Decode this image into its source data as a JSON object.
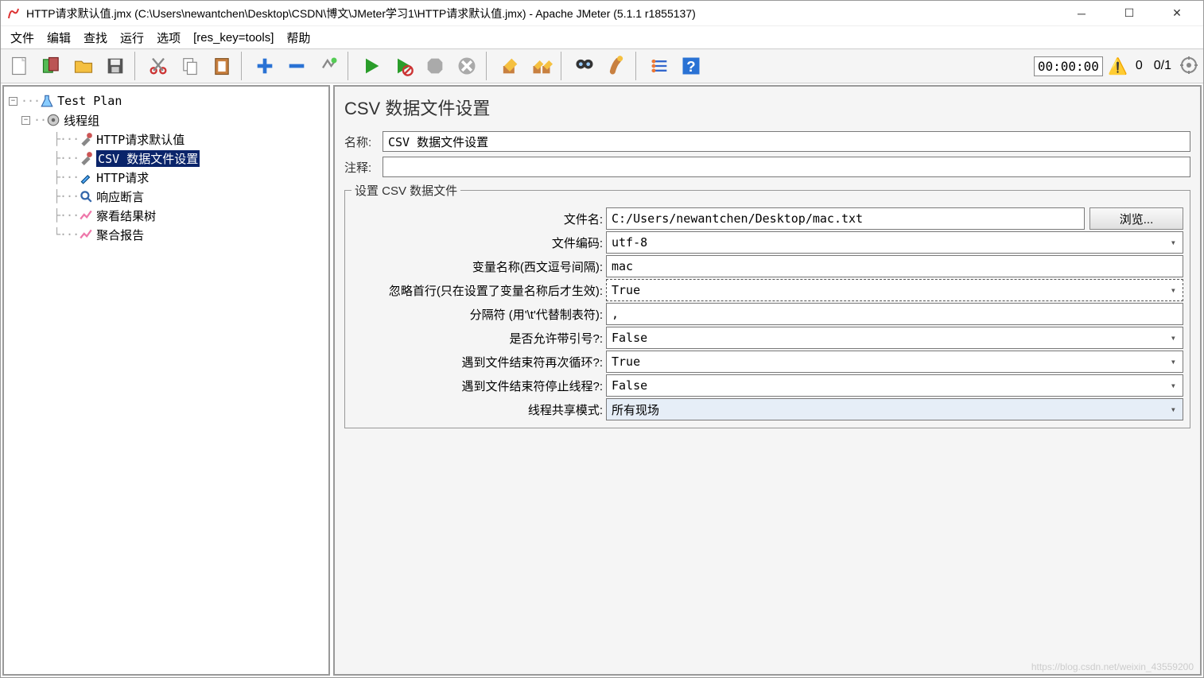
{
  "title": "HTTP请求默认值.jmx (C:\\Users\\newantchen\\Desktop\\CSDN\\博文\\JMeter学习1\\HTTP请求默认值.jmx) - Apache JMeter (5.1.1 r1855137)",
  "menu": {
    "file": "文件",
    "edit": "编辑",
    "find": "查找",
    "run": "运行",
    "options": "选项",
    "reskey": "[res_key=tools]",
    "help": "帮助"
  },
  "toolbar_right": {
    "timer": "00:00:00",
    "warn_count": "0",
    "threads": "0/1"
  },
  "tree": {
    "root": "Test Plan",
    "group": "线程组",
    "items": {
      "0": "HTTP请求默认值",
      "1": "CSV 数据文件设置",
      "2": "HTTP请求",
      "3": "响应断言",
      "4": "察看结果树",
      "5": "聚合报告"
    }
  },
  "panel": {
    "title": "CSV 数据文件设置",
    "name_label": "名称:",
    "name_value": "CSV 数据文件设置",
    "comment_label": "注释:",
    "comment_value": "",
    "fieldset_legend": "设置 CSV 数据文件",
    "browse": "浏览...",
    "rows": {
      "filename": {
        "label": "文件名:",
        "value": "C:/Users/newantchen/Desktop/mac.txt"
      },
      "encoding": {
        "label": "文件编码:",
        "value": "utf-8"
      },
      "varnames": {
        "label": "变量名称(西文逗号间隔):",
        "value": "mac"
      },
      "ignoreFirst": {
        "label": "忽略首行(只在设置了变量名称后才生效):",
        "value": "True"
      },
      "delimiter": {
        "label": "分隔符 (用'\\t'代替制表符):",
        "value": ","
      },
      "quoted": {
        "label": "是否允许带引号?:",
        "value": "False"
      },
      "recycle": {
        "label": "遇到文件结束符再次循环?:",
        "value": "True"
      },
      "stopEOF": {
        "label": "遇到文件结束符停止线程?:",
        "value": "False"
      },
      "share": {
        "label": "线程共享模式:",
        "value": "所有现场"
      }
    }
  },
  "watermark": "https://blog.csdn.net/weixin_43559200"
}
